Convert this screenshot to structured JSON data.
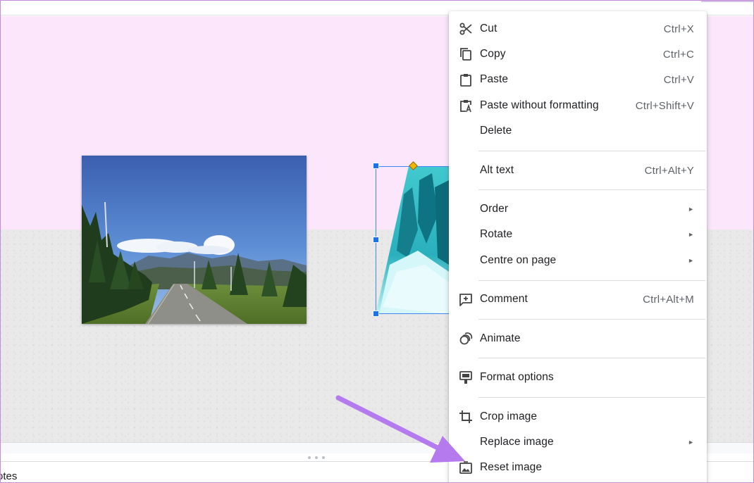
{
  "notes": {
    "label": "otes"
  },
  "menu": {
    "items": [
      {
        "id": "cut",
        "label": "Cut",
        "shortcut": "Ctrl+X",
        "icon": "scissors-icon"
      },
      {
        "id": "copy",
        "label": "Copy",
        "shortcut": "Ctrl+C",
        "icon": "copy-icon"
      },
      {
        "id": "paste",
        "label": "Paste",
        "shortcut": "Ctrl+V",
        "icon": "clipboard-icon"
      },
      {
        "id": "paste-plain",
        "label": "Paste without formatting",
        "shortcut": "Ctrl+Shift+V",
        "icon": "clipboard-text-icon"
      },
      {
        "id": "delete",
        "label": "Delete",
        "shortcut": ""
      },
      {
        "id": "alt-text",
        "label": "Alt text",
        "shortcut": "Ctrl+Alt+Y"
      },
      {
        "id": "order",
        "label": "Order",
        "submenu": true
      },
      {
        "id": "rotate",
        "label": "Rotate",
        "submenu": true
      },
      {
        "id": "centre",
        "label": "Centre on page",
        "submenu": true
      },
      {
        "id": "comment",
        "label": "Comment",
        "shortcut": "Ctrl+Alt+M",
        "icon": "add-comment-icon"
      },
      {
        "id": "animate",
        "label": "Animate",
        "icon": "animate-icon"
      },
      {
        "id": "format",
        "label": "Format options",
        "icon": "format-options-icon"
      },
      {
        "id": "crop",
        "label": "Crop image",
        "icon": "crop-icon"
      },
      {
        "id": "replace",
        "label": "Replace image",
        "submenu": true
      },
      {
        "id": "reset",
        "label": "Reset image",
        "icon": "reset-image-icon"
      }
    ],
    "submenu_glyph": "►"
  },
  "colors": {
    "slide_top": "#fbe6fc",
    "slide_bottom": "#e9e9e9",
    "selection": "#1a73e8",
    "annotation_arrow": "#b57bee"
  }
}
